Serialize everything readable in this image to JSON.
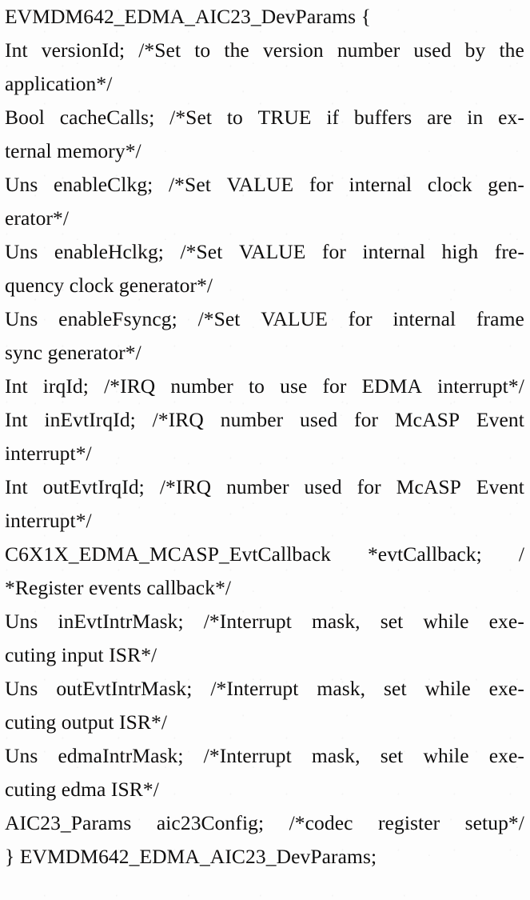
{
  "document": {
    "kind": "scanned-code-listing",
    "struct_name": "EVMDM642_EDMA_AIC23_DevParams",
    "text_color": "#100f0f",
    "page_color": "#fdfdfd",
    "lines": [
      {
        "id": "line-01",
        "text": "EVMDM642_EDMA_AIC23_DevParams {",
        "justified": false
      },
      {
        "id": "line-02",
        "text": "Int versionId; /*Set to the version number used by the",
        "justified": true
      },
      {
        "id": "line-03",
        "text": "application*/",
        "justified": false
      },
      {
        "id": "line-04",
        "text": "Bool cacheCalls;  /*Set to TRUE if buffers are in ex-",
        "justified": true
      },
      {
        "id": "line-05",
        "text": "ternal memory*/",
        "justified": false
      },
      {
        "id": "line-06",
        "text": "Uns enableClkg; /*Set VALUE for internal clock gen-",
        "justified": true
      },
      {
        "id": "line-07",
        "text": "erator*/",
        "justified": false
      },
      {
        "id": "line-08",
        "text": "Uns enableHclkg; /*Set VALUE for internal high fre-",
        "justified": true
      },
      {
        "id": "line-09",
        "text": "quency clock generator*/",
        "justified": false
      },
      {
        "id": "line-10",
        "text": "Uns enableFsyncg;  /*Set VALUE for internal frame",
        "justified": true
      },
      {
        "id": "line-11",
        "text": "sync generator*/",
        "justified": false
      },
      {
        "id": "line-12",
        "text": "Int irqId; /*IRQ number to use for EDMA interrupt*/",
        "justified": true
      },
      {
        "id": "line-13",
        "text": "Int inEvtIrqId;  /*IRQ number used for McASP Event",
        "justified": true
      },
      {
        "id": "line-14",
        "text": "interrupt*/",
        "justified": false
      },
      {
        "id": "line-15",
        "text": "Int outEvtIrqId; /*IRQ number used for McASP Event",
        "justified": true
      },
      {
        "id": "line-16",
        "text": "interrupt*/",
        "justified": false
      },
      {
        "id": "line-17",
        "text": "C6X1X_EDMA_MCASP_EvtCallback *evtCallback;  /",
        "justified": true
      },
      {
        "id": "line-18",
        "text": "*Register events callback*/",
        "justified": false
      },
      {
        "id": "line-19",
        "text": "Uns inEvtIntrMask;  /*Interrupt mask,  set while exe-",
        "justified": true
      },
      {
        "id": "line-20",
        "text": "cuting input ISR*/",
        "justified": false
      },
      {
        "id": "line-21",
        "text": "Uns outEvtIntrMask; /*Interrupt mask, set while exe-",
        "justified": true
      },
      {
        "id": "line-22",
        "text": "cuting output ISR*/",
        "justified": false
      },
      {
        "id": "line-23",
        "text": "Uns edmaIntrMask;  /*Interrupt mask,  set while exe-",
        "justified": true
      },
      {
        "id": "line-24",
        "text": "cuting edma ISR*/",
        "justified": false
      },
      {
        "id": "line-25",
        "text": "AIC23_Params aic23Config; /*codec register setup*/",
        "justified": true
      },
      {
        "id": "line-26",
        "text": "} EVMDM642_EDMA_AIC23_DevParams;",
        "justified": false
      }
    ]
  }
}
